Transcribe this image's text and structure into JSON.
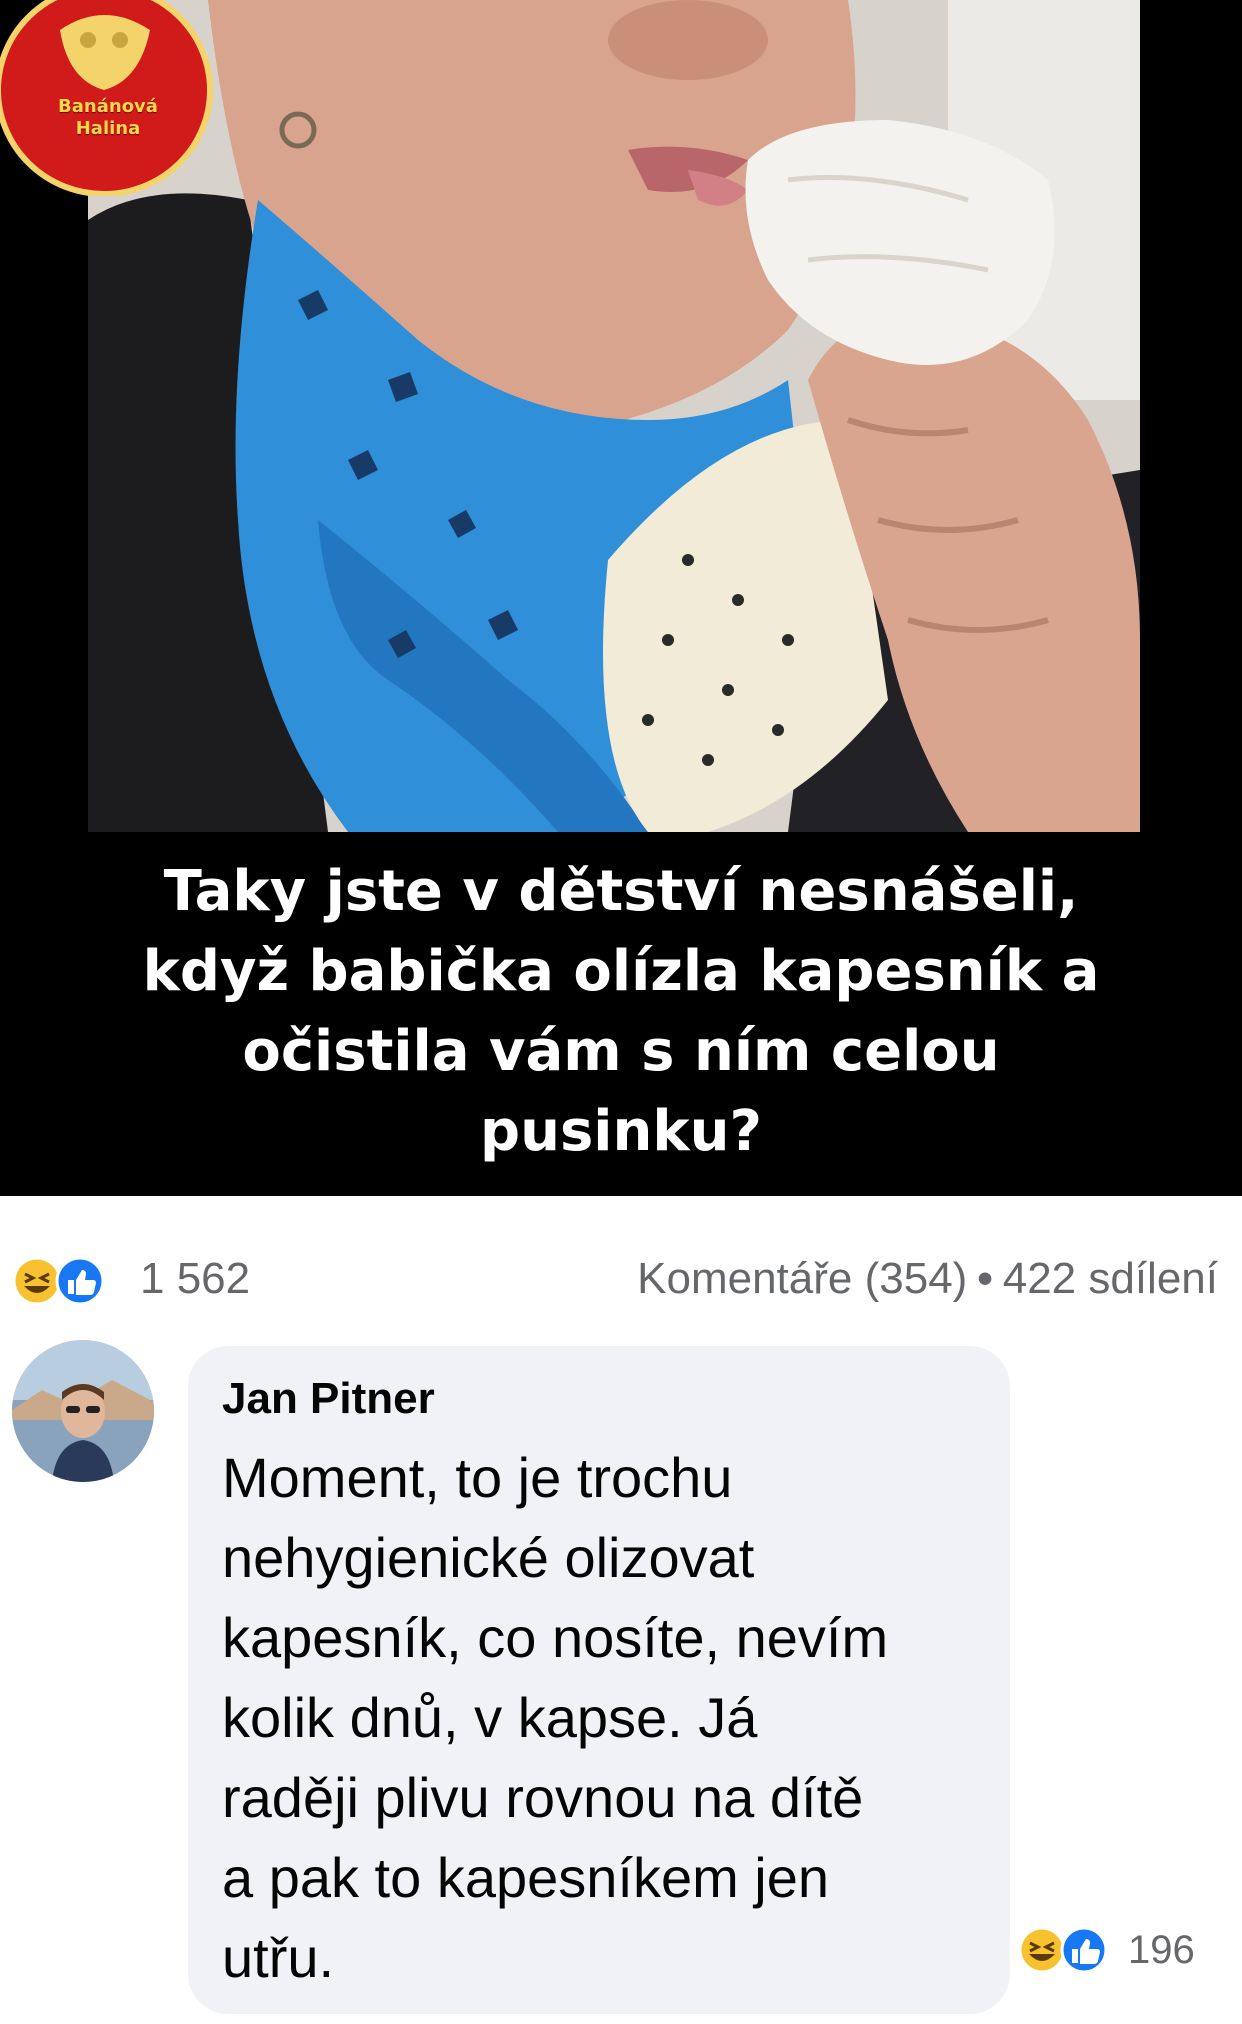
{
  "logo": {
    "line1": "Banánová",
    "line2": "Halina"
  },
  "caption": {
    "lines": [
      "Taky jste v dětství nesnášeli,",
      "když babička olízla kapesník a",
      "očistila vám s ním celou",
      "pusinku?"
    ]
  },
  "reactions": {
    "icons": [
      "haha-icon",
      "like-icon"
    ],
    "count": "1 562"
  },
  "meta": {
    "comments": "Komentáře (354)",
    "separator": "•",
    "shares": "422 sdílení"
  },
  "comment": {
    "author": "Jan Pitner",
    "lines": [
      "Moment, to je trochu",
      "nehygienické olizovat",
      "kapesník, co nosíte, nevím",
      "kolik dnů, v kapse. Já",
      "raději plivu rovnou na dítě",
      "a pak to kapesníkem jen",
      "utřu."
    ],
    "reaction_icons": [
      "haha-icon",
      "like-icon"
    ],
    "reaction_count": "196"
  },
  "colors": {
    "like_blue": "#1877f2",
    "haha_yellow": "#f7c12f",
    "logo_red": "#d11a1a",
    "scarf_blue": "#2f8fd8"
  }
}
